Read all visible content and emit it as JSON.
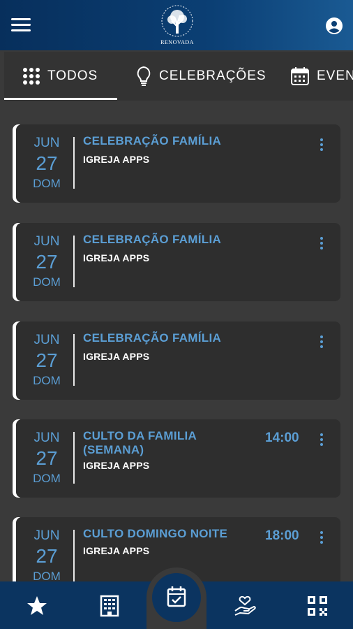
{
  "header": {
    "logo_text": "RENOVADA",
    "menu_icon": "hamburger-menu-icon",
    "account_icon": "account-circle-icon"
  },
  "tabs": [
    {
      "label": "TODOS",
      "icon": "grid-dots-icon",
      "active": true
    },
    {
      "label": "CELEBRAÇÕES",
      "icon": "lightbulb-icon",
      "active": false
    },
    {
      "label": "EVENTOS",
      "icon": "calendar-icon",
      "active": false
    }
  ],
  "events": [
    {
      "month": "JUN",
      "day": "27",
      "weekday": "DOM",
      "title": "CELEBRAÇÃO FAMÍLIA",
      "subtitle": "IGREJA APPS",
      "time": ""
    },
    {
      "month": "JUN",
      "day": "27",
      "weekday": "DOM",
      "title": "CELEBRAÇÃO FAMÍLIA",
      "subtitle": "IGREJA APPS",
      "time": ""
    },
    {
      "month": "JUN",
      "day": "27",
      "weekday": "DOM",
      "title": "CELEBRAÇÃO FAMÍLIA",
      "subtitle": "IGREJA APPS",
      "time": ""
    },
    {
      "month": "JUN",
      "day": "27",
      "weekday": "DOM",
      "title": "CULTO DA FAMILIA (SEMANA)",
      "subtitle": "IGREJA APPS",
      "time": "14:00"
    },
    {
      "month": "JUN",
      "day": "27",
      "weekday": "DOM",
      "title": "CULTO DOMINGO NOITE",
      "subtitle": "IGREJA APPS",
      "time": "18:00"
    }
  ],
  "bottom_nav": [
    {
      "icon": "star-icon"
    },
    {
      "icon": "building-icon"
    },
    {
      "icon": "calendar-check-icon",
      "active": true
    },
    {
      "icon": "donation-hand-icon"
    },
    {
      "icon": "qr-code-icon"
    }
  ],
  "colors": {
    "header_bg": "#0b3f74",
    "accent_blue": "#5b9ed4",
    "card_bg": "#2e2e2e",
    "page_bg": "#3a3a3a",
    "bottom_nav_bg": "#0b3460"
  }
}
